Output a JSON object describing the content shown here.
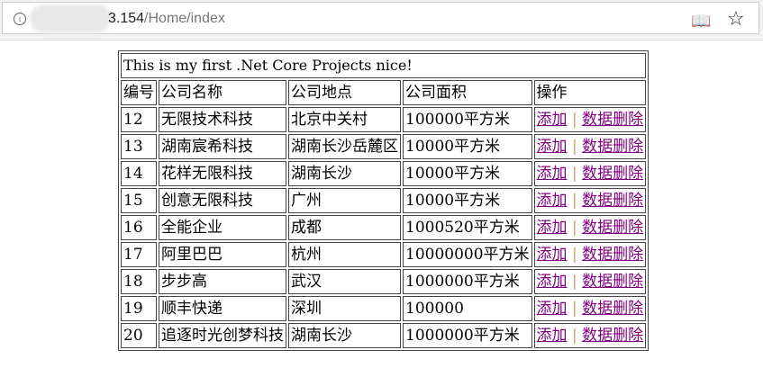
{
  "browser": {
    "url_visible": "3.154",
    "url_path": "/Home/index"
  },
  "table": {
    "caption": "This is my first .Net Core Projects nice!",
    "headers": [
      "编号",
      "公司名称",
      "公司地点",
      "公司面积",
      "操作"
    ],
    "add_label": "添加",
    "separator": "|",
    "delete_label": "数据删除",
    "rows": [
      [
        "12",
        "无限技术科技",
        "北京中关村",
        "100000平方米"
      ],
      [
        "13",
        "湖南宸希科技",
        "湖南长沙岳麓区",
        "10000平方米"
      ],
      [
        "14",
        "花样无限科技",
        "湖南长沙",
        "10000平方米"
      ],
      [
        "15",
        "创意无限科技",
        "广州",
        "10000平方米"
      ],
      [
        "16",
        "全能企业",
        "成都",
        "1000520平方米"
      ],
      [
        "17",
        "阿里巴巴",
        "杭州",
        "10000000平方米"
      ],
      [
        "18",
        "步步高",
        "武汉",
        "1000000平方米"
      ],
      [
        "19",
        "顺丰快递",
        "深圳",
        "100000"
      ],
      [
        "20",
        "追逐时光创梦科技",
        "湖南长沙",
        "1000000平方米"
      ]
    ]
  }
}
